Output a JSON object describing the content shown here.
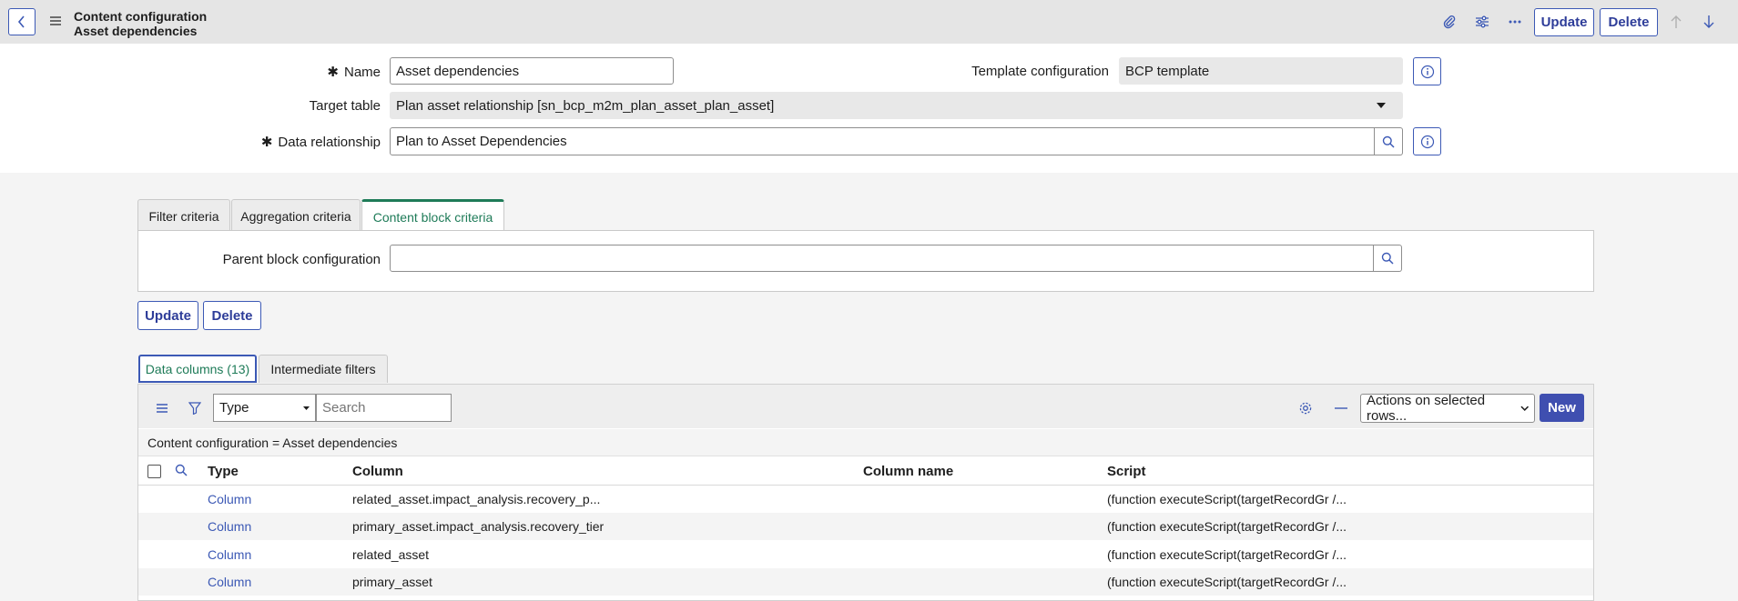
{
  "header": {
    "title_line1": "Content configuration",
    "title_line2": "Asset dependencies",
    "update_label": "Update",
    "delete_label": "Delete"
  },
  "form": {
    "name_label": "Name",
    "name_value": "Asset dependencies",
    "template_label": "Template configuration",
    "template_value": "BCP template",
    "target_label": "Target table",
    "target_value": "Plan asset relationship [sn_bcp_m2m_plan_asset_plan_asset]",
    "relationship_label": "Data relationship",
    "relationship_value": "Plan to Asset Dependencies",
    "required_mark": "✱"
  },
  "tabs": [
    {
      "label": "Filter criteria"
    },
    {
      "label": "Aggregation criteria"
    },
    {
      "label": "Content block criteria"
    }
  ],
  "panel": {
    "parent_label": "Parent block configuration",
    "parent_value": ""
  },
  "actions": {
    "update_label": "Update",
    "delete_label": "Delete"
  },
  "related_tabs": [
    {
      "label": "Data columns (13)"
    },
    {
      "label": "Intermediate filters"
    }
  ],
  "list": {
    "filter_field": "Type",
    "search_placeholder": "Search",
    "actions_select": "Actions on selected rows...",
    "new_label": "New",
    "breadcrumb": "Content configuration = Asset dependencies",
    "columns": [
      "Type",
      "Column",
      "Column name",
      "Script"
    ],
    "rows": [
      {
        "type": "Column",
        "column": "related_asset.impact_analysis.recovery_p...",
        "column_name": "",
        "script": "(function executeScript(targetRecordGr /..."
      },
      {
        "type": "Column",
        "column": "primary_asset.impact_analysis.recovery_tier",
        "column_name": "",
        "script": "(function executeScript(targetRecordGr /..."
      },
      {
        "type": "Column",
        "column": "related_asset",
        "column_name": "",
        "script": "(function executeScript(targetRecordGr /..."
      },
      {
        "type": "Column",
        "column": "primary_asset",
        "column_name": "",
        "script": "(function executeScript(targetRecordGr /..."
      }
    ]
  },
  "colors": {
    "accent": "#3c59b5",
    "active_tab": "#1e7b58",
    "new_button": "#3f4fb0"
  }
}
